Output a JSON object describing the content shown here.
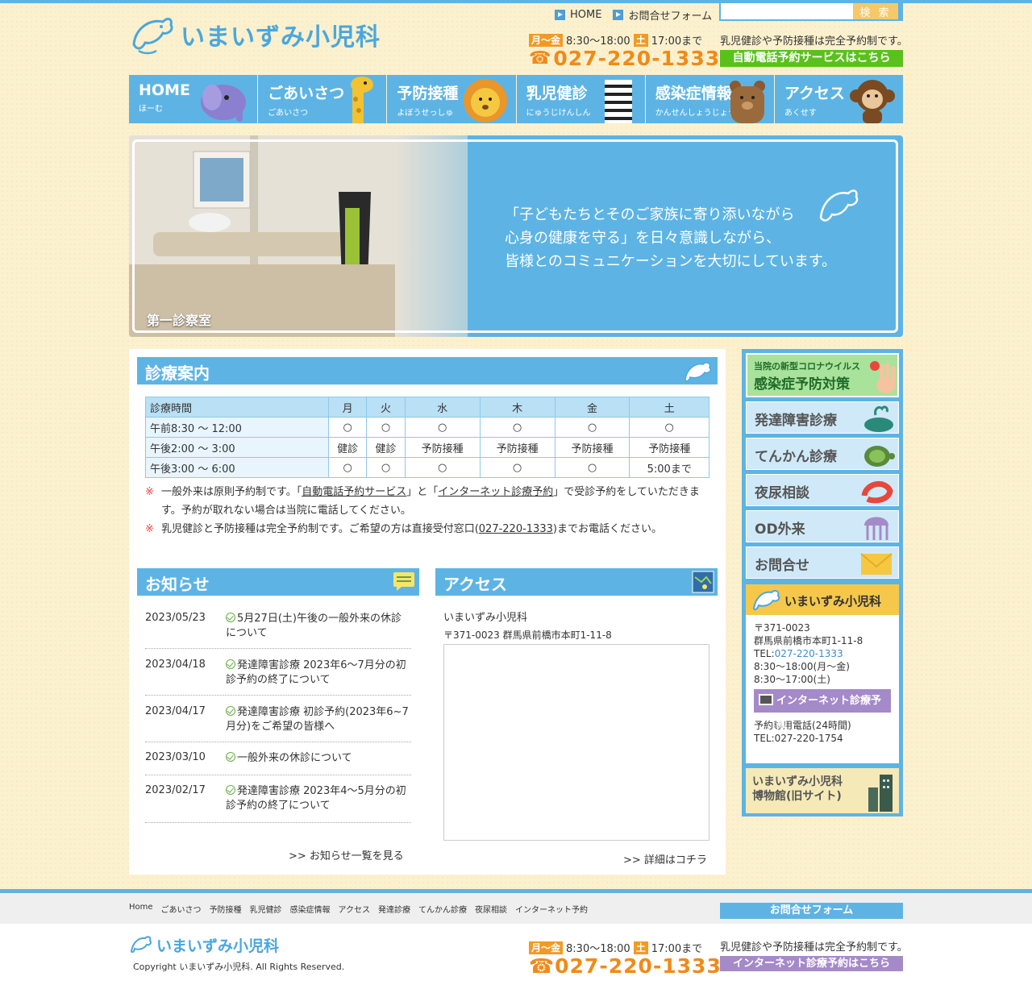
{
  "header": {
    "logo_text": "いまいずみ小児科",
    "nav_home": "HOME",
    "nav_contact": "お問合せフォーム",
    "search_button": "検 索",
    "search_value": "",
    "days_weekday": "月〜金",
    "hours_weekday": "8:30〜18:00",
    "days_sat": "土",
    "hours_sat": "17:00まで",
    "phone": "027-220-1333",
    "notice": "乳児健診や予防接種は完全予約制です。",
    "autocall_button": "自動電話予約サービスはこちら"
  },
  "gnav": [
    {
      "label": "HOME",
      "kana": "ほーむ"
    },
    {
      "label": "ごあいさつ",
      "kana": "ごあいさつ"
    },
    {
      "label": "予防接種",
      "kana": "よぼうせっしゅ"
    },
    {
      "label": "乳児健診",
      "kana": "にゅうじけんしん"
    },
    {
      "label": "感染症情報",
      "kana": "かんせんしょうじょうほう"
    },
    {
      "label": "アクセス",
      "kana": "あくせす"
    }
  ],
  "hero": {
    "quote1": "「子どもたちとそのご家族に寄り添いながら",
    "quote2": "心身の健康を守る」を日々意識しながら、",
    "quote3": "皆様とのコミュニケーションを大切にしています。",
    "caption": "第一診察室"
  },
  "schedule": {
    "title": "診療案内",
    "header": [
      "診療時間",
      "月",
      "火",
      "水",
      "木",
      "金",
      "土"
    ],
    "rows": [
      [
        "午前8:30 〜 12:00",
        "○",
        "○",
        "○",
        "○",
        "○",
        "○"
      ],
      [
        "午後2:00 〜 3:00",
        "健診",
        "健診",
        "予防接種",
        "予防接種",
        "予防接種",
        "予防接種"
      ],
      [
        "午後3:00 〜 6:00",
        "○",
        "○",
        "○",
        "○",
        "○",
        "5:00まで"
      ]
    ],
    "note_mark": "※",
    "note1_a": "一般外来は原則予約制です。「",
    "note1_link1": "自動電話予約サービス",
    "note1_b": "」と「",
    "note1_link2": "インターネット診療予約",
    "note1_c": "」で受診予約をしていただきます。予約が取れない場合は当院に電話してください。",
    "note2_a": "乳児健診と予防接種は完全予約制です。ご希望の方は直接受付窓口(",
    "note2_link": "027-220-1333",
    "note2_b": ")までお電話ください。"
  },
  "news": {
    "title": "お知らせ",
    "items": [
      {
        "date": "2023/05/23",
        "title": "5月27日(土)午後の一般外来の休診について"
      },
      {
        "date": "2023/04/18",
        "title": "発達障害診療 2023年6〜7月分の初診予約の終了について"
      },
      {
        "date": "2023/04/17",
        "title": "発達障害診療 初診予約(2023年6~7月分)をご希望の皆様へ"
      },
      {
        "date": "2023/03/10",
        "title": "一般外来の休診について"
      },
      {
        "date": "2023/02/17",
        "title": "発達障害診療 2023年4〜5月分の初診予約の終了について"
      }
    ],
    "more": "お知らせ一覧を見る"
  },
  "access": {
    "title": "アクセス",
    "name": "いまいずみ小児科",
    "address": "〒371-0023 群馬県前橋市本町1-11-8",
    "more": "詳細はコチラ"
  },
  "sidebar": {
    "corona_small": "当院の新型コロナウイルス",
    "corona_big": "感染症予防対策",
    "buttons": [
      "発達障害診療",
      "てんかん診療",
      "夜尿相談",
      "OD外来",
      "お問合せ"
    ],
    "clinic_name": "いまいずみ小児科",
    "zip": "〒371-0023",
    "addr": "群馬県前橋市本町1-11-8",
    "tel_label": "TEL:",
    "tel": "027-220-1333",
    "hours1": "8:30〜18:00(月〜金)",
    "hours2": "8:30〜17:00(土)",
    "net_button": "インターネット診療予約",
    "reserve_label": "予約専用電話(24時間)",
    "reserve_tel": "TEL:027-220-1754",
    "museum1": "いまいずみ小児科",
    "museum2": "博物館(旧サイト)"
  },
  "footer": {
    "links": [
      "Home",
      "ごあいさつ",
      "予防接種",
      "乳児健診",
      "感染症情報",
      "アクセス",
      "発達診療",
      "てんかん診療",
      "夜尿相談",
      "インターネット予約"
    ],
    "contact_button": "お問合せフォーム",
    "logo_text": "いまいずみ小児科",
    "copyright": "Copyright いまいずみ小児科. All Rights Reserved.",
    "net_button": "インターネット診療予約はこちら"
  },
  "colors": {
    "accent": "#5db4e4",
    "orange": "#f08a18",
    "green": "#5ac11c",
    "purple": "#a58ac9",
    "bg": "#fcf1cf"
  }
}
